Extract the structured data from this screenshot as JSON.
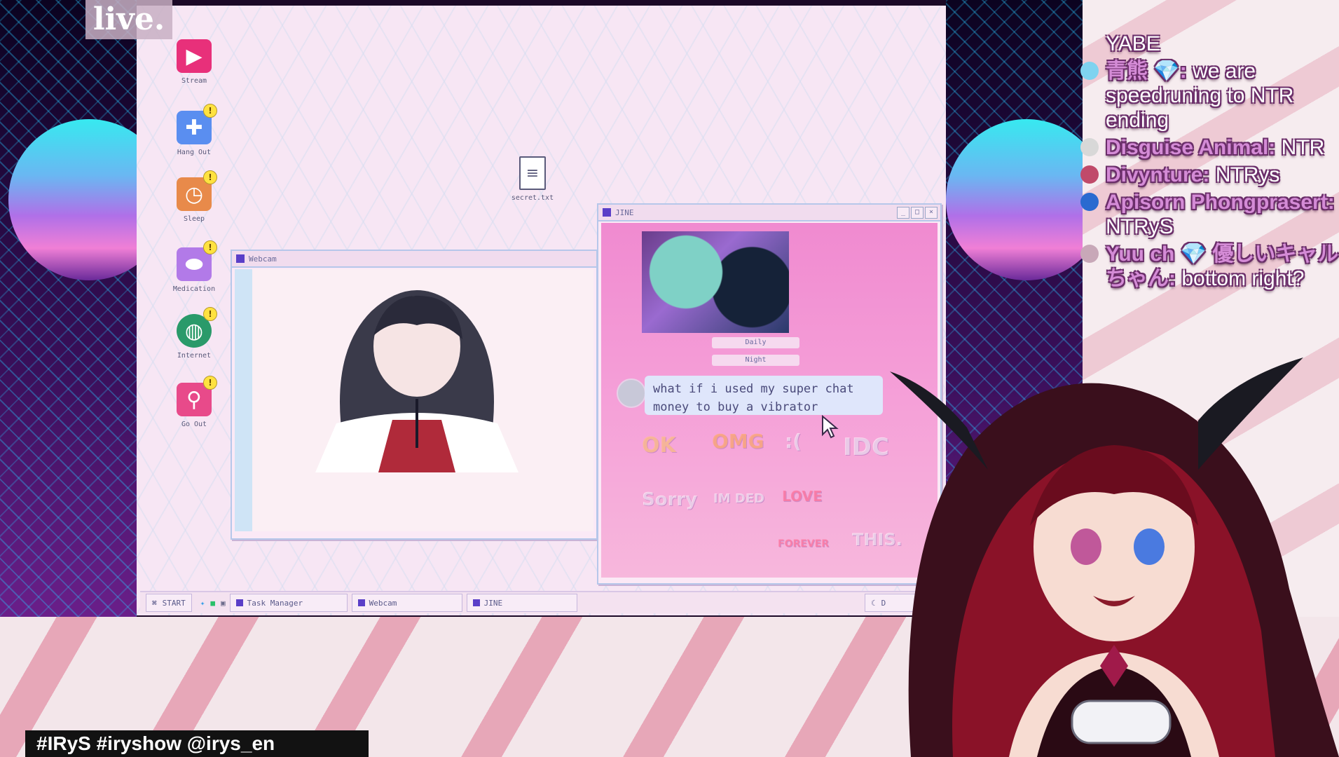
{
  "overlay": {
    "logo": "live.",
    "hashtags": "#IRyS #iryshow @irys_en"
  },
  "desktop_icons": [
    {
      "label": "Stream",
      "icon": "stream-play-icon",
      "badge": ""
    },
    {
      "label": "Hang Out",
      "icon": "hangout-icon",
      "badge": "!"
    },
    {
      "label": "Sleep",
      "icon": "alarm-clock-icon",
      "badge": "!"
    },
    {
      "label": "Medication",
      "icon": "pills-icon",
      "badge": "!"
    },
    {
      "label": "Internet",
      "icon": "globe-search-icon",
      "badge": "!"
    },
    {
      "label": "Go Out",
      "icon": "map-pin-icon",
      "badge": "!"
    },
    {
      "label": "secret.txt",
      "icon": "text-file-icon",
      "badge": ""
    }
  ],
  "webcam_window": {
    "title": "Webcam"
  },
  "jine_window": {
    "title": "JINE",
    "buttons": [
      "_",
      "□",
      "×"
    ],
    "pills": [
      "Daily",
      "Night"
    ],
    "message": "what if i used my super chat money to buy a vibrator",
    "stamps": [
      "OK",
      "OMG",
      ":(",
      "IDC",
      "Sorry",
      "IM DED",
      "LOVE",
      "FOREVER",
      "THIS."
    ]
  },
  "taskbar": {
    "start": "START",
    "items": [
      "Task Manager",
      "Webcam",
      "JINE"
    ],
    "clock": "D"
  },
  "chat": [
    {
      "name": "",
      "text": "YABE",
      "avatar": ""
    },
    {
      "name": "青熊 💎:",
      "text": "we are speedruning to NTR ending",
      "avatar": "#7fd3f0"
    },
    {
      "name": "Disguise Animal:",
      "text": "NTR",
      "avatar": "#d8d8d8"
    },
    {
      "name": "Divynture:",
      "text": "NTRys",
      "avatar": "#c04a6a"
    },
    {
      "name": "Apisorn Phongprasert:",
      "text": "NTRyS",
      "avatar": "#2a6ad0"
    },
    {
      "name": "Yuu ch 💎 優しいキャルちゃん:",
      "text": "bottom right?",
      "avatar": "#c8a8b8"
    }
  ],
  "colors": {
    "desktop_bg": "#f7e6f4",
    "window_border": "#b6c7ea",
    "jine_pink": "#f08ad0",
    "chat_name": "#d48bd6"
  }
}
